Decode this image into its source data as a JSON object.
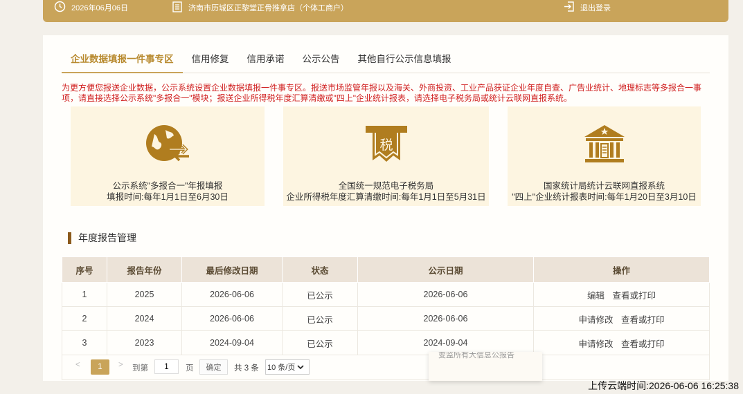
{
  "topbar": {
    "date": "2026年06月06日",
    "shop": "济南市历城区正黎堂正骨推拿店（个体工商户）",
    "logout": "退出登录"
  },
  "tabs": [
    {
      "label": "企业数据填报一件事专区",
      "active": true
    },
    {
      "label": "信用修复"
    },
    {
      "label": "信用承诺"
    },
    {
      "label": "公示公告"
    },
    {
      "label": "其他自行公示信息填报"
    }
  ],
  "notice": "为更方便您报送企业数据，公示系统设置企业数据填报一件事专区。报送市场监管年报以及海关、外商投资、工业产品获证企业年度自查、广告业统计、地理标志等多报合一事项，请直接选择公示系统\"多报合一\"模块；报送企业所得税年度汇算清缴或\"四上\"企业统计报表，请选择电子税务局或统计云联网直报系统。",
  "cards": [
    {
      "icon": "globe-exchange-icon",
      "line1": "公示系统\"多报合一\"年报填报",
      "line2": "填报时间:每年1月1日至6月30日"
    },
    {
      "icon": "tax-ticket-icon",
      "line1": "全国统一规范电子税务局",
      "line2": "企业所得税年度汇算清缴时间:每年1月1日至5月31日",
      "glyph": "税"
    },
    {
      "icon": "government-building-icon",
      "line1": "国家统计局统计云联网直报系统",
      "line2": "\"四上\"企业统计报表时间:每年1月20日至3月10日"
    }
  ],
  "section_title": "年度报告管理",
  "table": {
    "headers": [
      "序号",
      "报告年份",
      "最后修改日期",
      "状态",
      "公示日期",
      "操作"
    ],
    "rows": [
      {
        "no": "1",
        "year": "2025",
        "modified": "2026-06-06",
        "status": "已公示",
        "published": "2026-06-06",
        "action1": "编辑",
        "action2": "查看或打印"
      },
      {
        "no": "2",
        "year": "2024",
        "modified": "2026-06-06",
        "status": "已公示",
        "published": "2026-06-06",
        "action1": "申请修改",
        "action2": "查看或打印"
      },
      {
        "no": "3",
        "year": "2023",
        "modified": "2024-09-04",
        "status": "已公示",
        "published": "2024-09-04",
        "action1": "申请修改",
        "action2": "查看或打印"
      }
    ]
  },
  "pager": {
    "prev": "<",
    "current": "1",
    "next": ">",
    "goto": "到第",
    "input_value": "1",
    "page": "页",
    "confirm": "确定",
    "total": "共 3 条",
    "page_size": "10 条/页"
  },
  "popup_text": "变监所有大信息公报告",
  "upload_time": "上传云端时间:2026-06-06 16:25:38",
  "colors": {
    "gold": "#c9a45a",
    "card_bg": "#fdf5e1",
    "notice_red": "#d02020",
    "header_bg": "#ece3d8",
    "icon_brown": "#b07d1f"
  }
}
